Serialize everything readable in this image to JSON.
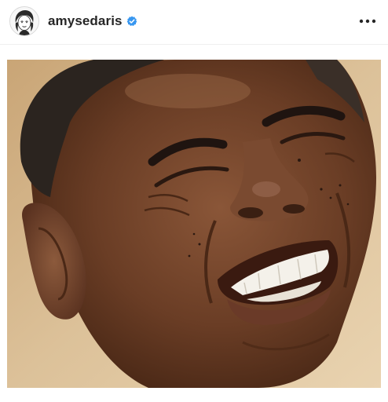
{
  "post": {
    "username": "amysedaris",
    "verified": true,
    "avatar_icon": "profile-avatar-illustration",
    "more_icon": "more-horizontal-icon",
    "media_description_icon": "photo"
  },
  "colors": {
    "username": "#262626",
    "verified_badge": "#3897f0",
    "background": "#ffffff",
    "photo_background": "#d9c09a"
  }
}
